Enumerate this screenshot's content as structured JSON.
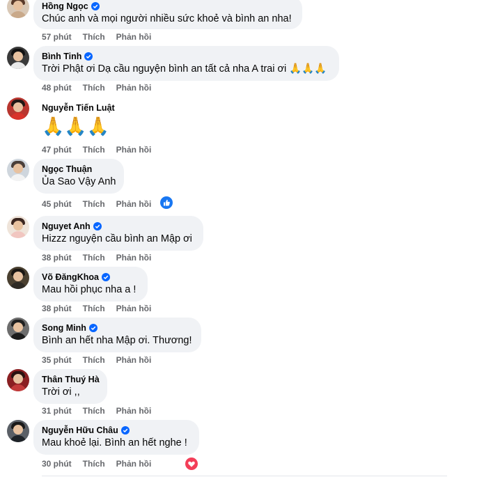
{
  "comments": [
    {
      "name": "Hồng Ngọc",
      "verified": true,
      "text": "Chúc anh và mọi người nhiều sức khoẻ và bình an nha!",
      "time": "57 phút",
      "like": "Thích",
      "reply": "Phản hồi",
      "reaction": null,
      "plain": false
    },
    {
      "name": "Bình Tinh",
      "verified": true,
      "text": "Trời Phật ơi Dạ cầu nguyện bình an tất cả nha A trai ơi 🙏🙏🙏",
      "time": "48 phút",
      "like": "Thích",
      "reply": "Phản hồi",
      "reaction": null,
      "plain": false
    },
    {
      "name": "Nguyễn Tiến Luật",
      "verified": false,
      "text": "🙏🙏🙏",
      "time": "47 phút",
      "like": "Thích",
      "reply": "Phản hồi",
      "reaction": null,
      "plain": true
    },
    {
      "name": "Ngọc Thuận",
      "verified": false,
      "text": "Ủa Sao Vậy Anh",
      "time": "45 phút",
      "like": "Thích",
      "reply": "Phản hồi",
      "reaction": "like-reaction-icon",
      "plain": false
    },
    {
      "name": "Nguyet Anh",
      "verified": true,
      "text": "Hizzz nguyện cầu bình an Mập ơi",
      "time": "38 phút",
      "like": "Thích",
      "reply": "Phản hồi",
      "reaction": null,
      "plain": false
    },
    {
      "name": "Võ ĐăngKhoa",
      "verified": true,
      "text": "Mau hồi phục nha a !",
      "time": "38 phút",
      "like": "Thích",
      "reply": "Phản hồi",
      "reaction": null,
      "plain": false
    },
    {
      "name": "Song Minh",
      "verified": true,
      "text": "Bình an hết nha Mập ơi. Thương!",
      "time": "35 phút",
      "like": "Thích",
      "reply": "Phản hồi",
      "reaction": null,
      "plain": false
    },
    {
      "name": "Thân Thuý Hà",
      "verified": false,
      "text": "Trời ơi ,,",
      "time": "31 phút",
      "like": "Thích",
      "reply": "Phản hồi",
      "reaction": null,
      "plain": false
    },
    {
      "name": "Nguyễn Hữu Châu",
      "verified": true,
      "text": "Mau khoẻ lại. Bình an hết nghe !",
      "time": "30 phút",
      "like": "Thích",
      "reply": "Phản hồi",
      "reaction": "love-reaction-icon",
      "plain": false
    }
  ],
  "colors": {
    "bubble": "#f0f2f5",
    "verified": "#0866ff",
    "meta": "#65676b",
    "like": "#1877f2",
    "love": "#f33e58"
  }
}
